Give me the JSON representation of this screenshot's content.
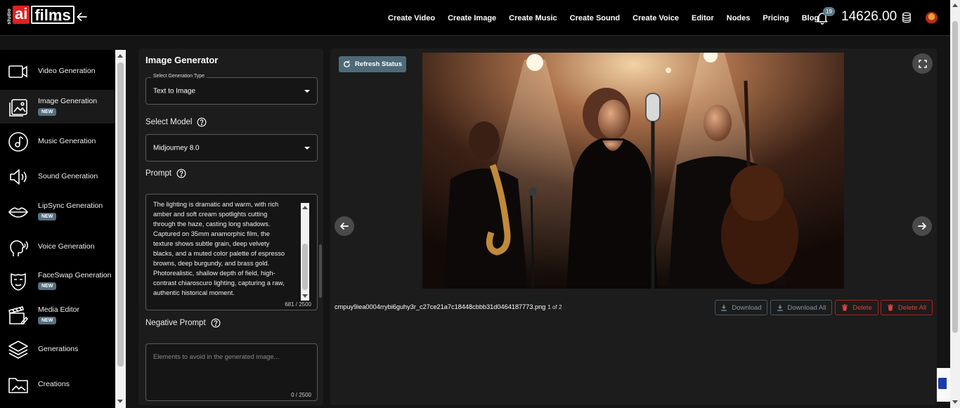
{
  "brand": {
    "studio": "studio",
    "ai": "ai",
    "films": "films",
    "beta": "beta"
  },
  "nav": {
    "links": [
      "Create Video",
      "Create Image",
      "Create Music",
      "Create Sound",
      "Create Voice",
      "Editor",
      "Nodes",
      "Pricing",
      "Blog"
    ],
    "notifications": "19",
    "credits": "14626.00"
  },
  "sidebar": {
    "items": [
      {
        "label": "Video Generation",
        "icon": "video-camera-icon",
        "badge": ""
      },
      {
        "label": "Image Generation",
        "icon": "image-icon",
        "badge": "NEW"
      },
      {
        "label": "Music Generation",
        "icon": "music-note-icon",
        "badge": ""
      },
      {
        "label": "Sound Generation",
        "icon": "speaker-icon",
        "badge": ""
      },
      {
        "label": "LipSync Generation",
        "icon": "lips-icon",
        "badge": "NEW"
      },
      {
        "label": "Voice Generation",
        "icon": "voice-head-icon",
        "badge": ""
      },
      {
        "label": "FaceSwap Generation",
        "icon": "mask-icon",
        "badge": "NEW"
      },
      {
        "label": "Media Editor",
        "icon": "clapperboard-icon",
        "badge": "NEW"
      },
      {
        "label": "Generations",
        "icon": "layers-icon",
        "badge": ""
      },
      {
        "label": "Creations",
        "icon": "folder-image-icon",
        "badge": ""
      }
    ]
  },
  "form": {
    "title": "Image Generator",
    "generation_type": {
      "label": "Select Generation Type",
      "value": "Text to Image"
    },
    "model": {
      "label": "Select Model",
      "value": "Midjourney 8.0"
    },
    "prompt": {
      "label": "Prompt",
      "lines": [
        "The lighting is dramatic and warm, with rich",
        "amber and soft cream spotlights cutting",
        "through the haze, casting long shadows.",
        "Captured on 35mm anamorphic film, the",
        "texture shows subtle grain, deep velvety",
        "blacks, and a muted color palette of espresso",
        "browns, deep burgundy, and brass gold.",
        "Photorealistic, shallow depth of field, high-",
        "contrast chiaroscuro lighting, capturing a raw,",
        "authentic historical moment."
      ],
      "counter": "681 / 2500"
    },
    "negative_prompt": {
      "label": "Negative Prompt",
      "placeholder": "Elements to avoid in the generated image...",
      "counter": "0 / 2500"
    }
  },
  "preview": {
    "refresh_label": "Refresh Status",
    "filename": "cmpuy9iea0004rrybi6guhy3r_c27ce21a7c18448cbbb31d0464187773.png",
    "position": "1 of 2",
    "actions": {
      "download": "Download",
      "download_all": "Download All",
      "delete": "Delete",
      "delete_all": "Delete All"
    }
  }
}
